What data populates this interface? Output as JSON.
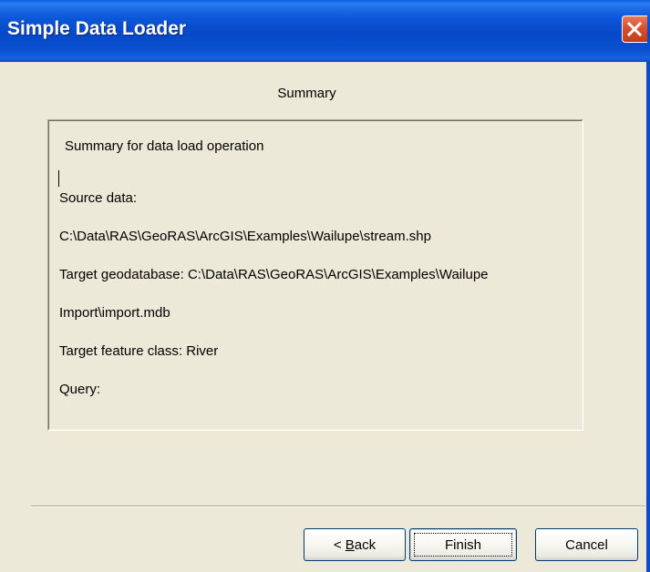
{
  "window": {
    "title": "Simple Data Loader",
    "close_icon": "close-icon",
    "close_color": "#d5502f"
  },
  "page": {
    "heading": "Summary"
  },
  "summary": {
    "caption": "Summary for data load operation",
    "lines": [
      "Source data:",
      "C:\\Data\\RAS\\GeoRAS\\ArcGIS\\Examples\\Wailupe\\stream.shp",
      "Target geodatabase: C:\\Data\\RAS\\GeoRAS\\ArcGIS\\Examples\\Wailupe",
      "Import\\import.mdb",
      "Target feature class: River",
      "Query:"
    ]
  },
  "buttons": {
    "back_prefix": "< ",
    "back_accel": "B",
    "back_rest": "ack",
    "finish": "Finish",
    "cancel": "Cancel"
  }
}
